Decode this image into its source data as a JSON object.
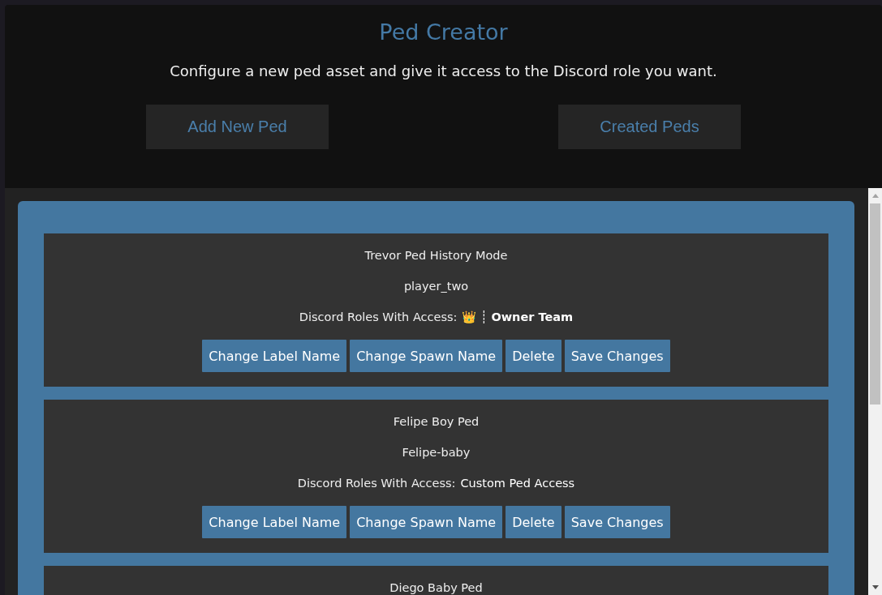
{
  "header": {
    "title": "Ped Creator",
    "subtitle": "Configure a new ped asset and give it access to the Discord role you want.",
    "buttons": [
      "Add New Ped",
      "Created Peds"
    ]
  },
  "peds": [
    {
      "label": "Trevor Ped History Mode",
      "spawn_name": "player_two",
      "roles_label": "Discord Roles With Access:",
      "role": "👑 ┊ **Owner Team**",
      "actions": [
        "Change Label Name",
        "Change Spawn Name",
        "Delete",
        "Save Changes"
      ]
    },
    {
      "label": "Felipe Boy Ped",
      "spawn_name": "Felipe-baby",
      "roles_label": "Discord Roles With Access:",
      "role": "Custom Ped Access",
      "actions": [
        "Change Label Name",
        "Change Spawn Name",
        "Delete",
        "Save Changes"
      ]
    },
    {
      "label": "Diego Baby Ped"
    }
  ]
}
